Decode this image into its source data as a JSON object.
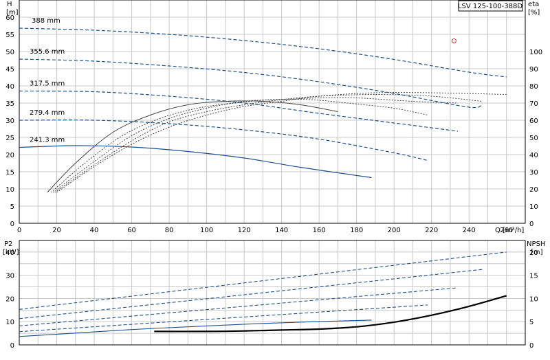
{
  "chart_data": [
    {
      "type": "line",
      "title": "LSV 125-100-388D",
      "xlabel": "Q [m³/h]",
      "ylabel": "H",
      "ylabel_unit": "[m]",
      "y2label": "eta",
      "y2label_unit": "[%]",
      "xlim": [
        0,
        270
      ],
      "ylim": [
        0,
        65
      ],
      "y2lim": [
        0,
        130
      ],
      "xticks": [
        "0",
        "20",
        "40",
        "60",
        "80",
        "100",
        "120",
        "140",
        "160",
        "180",
        "200",
        "220",
        "240",
        "260"
      ],
      "yticks": [
        "0",
        "5",
        "10",
        "15",
        "20",
        "25",
        "30",
        "35",
        "40",
        "45",
        "50",
        "55",
        "60"
      ],
      "y2ticks": [
        "0",
        "10",
        "20",
        "30",
        "40",
        "50",
        "60",
        "70",
        "80",
        "90",
        "100"
      ],
      "grid": true,
      "series": [
        {
          "name": "388 mm",
          "style": "dashed",
          "color": "#1f4f8f",
          "x": [
            0,
            40,
            80,
            120,
            160,
            200,
            240,
            260
          ],
          "y": [
            56.8,
            56.2,
            55.0,
            53.2,
            50.8,
            47.7,
            44.0,
            42.6
          ]
        },
        {
          "name": "355.6 mm",
          "style": "dashed",
          "color": "#1f4f8f",
          "x": [
            0,
            40,
            80,
            120,
            160,
            200,
            240,
            247
          ],
          "y": [
            47.8,
            47.2,
            45.8,
            43.9,
            41.2,
            37.8,
            33.8,
            34.8
          ]
        },
        {
          "name": "317.5 mm",
          "style": "dashed",
          "color": "#1f4f8f",
          "x": [
            0,
            40,
            80,
            120,
            160,
            200,
            234
          ],
          "y": [
            38.5,
            38.3,
            37.0,
            35.0,
            32.0,
            29.2,
            26.8
          ]
        },
        {
          "name": "279.4 mm",
          "style": "dashed",
          "color": "#1f4f8f",
          "x": [
            0,
            40,
            80,
            120,
            160,
            200,
            218
          ],
          "y": [
            30.0,
            30.0,
            29.0,
            27.2,
            24.5,
            20.5,
            18.3
          ]
        },
        {
          "name": "241.3 mm",
          "style": "solid",
          "color": "#1f4f8f",
          "x": [
            0,
            30,
            60,
            90,
            120,
            150,
            188
          ],
          "y": [
            22.1,
            22.6,
            22.2,
            20.9,
            19.0,
            16.3,
            13.3
          ]
        }
      ],
      "efficiency_series": [
        {
          "axis": "eta",
          "style": "solid",
          "color": "#444444",
          "x": [
            15,
            30,
            50,
            70,
            90,
            110,
            130,
            150,
            170
          ],
          "y": [
            18,
            35,
            53,
            63,
            69,
            71,
            71,
            69,
            65
          ]
        },
        {
          "axis": "eta",
          "style": "dotted",
          "color": "#444444",
          "x": [
            17,
            35,
            55,
            75,
            95,
            115,
            135,
            155,
            175,
            200,
            218
          ],
          "y": [
            18,
            35,
            51,
            61,
            67,
            70,
            72,
            72,
            70,
            67,
            63
          ]
        },
        {
          "axis": "eta",
          "style": "dotted",
          "color": "#444444",
          "x": [
            18,
            40,
            60,
            80,
            100,
            120,
            140,
            160,
            180,
            210,
            234
          ],
          "y": [
            18,
            36,
            51,
            61,
            67,
            71,
            72,
            73,
            73,
            71,
            70
          ]
        },
        {
          "axis": "eta",
          "style": "dotted",
          "color": "#444444",
          "x": [
            19,
            40,
            60,
            80,
            100,
            120,
            140,
            160,
            190,
            220,
            247
          ],
          "y": [
            18,
            34,
            48,
            59,
            65,
            69,
            72,
            74,
            75,
            74,
            71
          ]
        },
        {
          "axis": "eta",
          "style": "dotted",
          "color": "#444444",
          "x": [
            20,
            40,
            60,
            80,
            100,
            120,
            140,
            160,
            190,
            220,
            260
          ],
          "y": [
            18,
            33,
            46,
            56,
            63,
            68,
            71,
            74,
            76,
            76,
            75
          ]
        }
      ],
      "operating_point": {
        "x": 232,
        "y": 53.1,
        "color": "#e03030"
      }
    },
    {
      "type": "line",
      "xlabel": "",
      "ylabel": "P2",
      "ylabel_unit": "[kW]",
      "y2label": "NPSH",
      "y2label_unit": "[m]",
      "xlim": [
        0,
        270
      ],
      "ylim": [
        0,
        45
      ],
      "y2lim": [
        0,
        22.5
      ],
      "yticks": [
        "0",
        "10",
        "20",
        "30",
        "40"
      ],
      "y2ticks": [
        "0",
        "5",
        "10",
        "15",
        "20"
      ],
      "grid": true,
      "series": [
        {
          "style": "dashed",
          "color": "#1f4f8f",
          "x": [
            0,
            260
          ],
          "y": [
            15.3,
            40.0
          ]
        },
        {
          "style": "dashed",
          "color": "#1f4f8f",
          "x": [
            0,
            247
          ],
          "y": [
            11.3,
            32.5
          ]
        },
        {
          "style": "dashed",
          "color": "#1f4f8f",
          "x": [
            0,
            234
          ],
          "y": [
            8.2,
            24.6
          ]
        },
        {
          "style": "dashed",
          "color": "#1f4f8f",
          "x": [
            0,
            218
          ],
          "y": [
            5.7,
            17.2
          ]
        },
        {
          "style": "solid",
          "color": "#1f4f8f",
          "x": [
            0,
            30,
            60,
            90,
            120,
            150,
            188
          ],
          "y": [
            3.6,
            5.1,
            6.6,
            7.8,
            8.9,
            9.8,
            10.7
          ]
        }
      ],
      "npsh_series": {
        "style": "solid",
        "color": "#000000",
        "x": [
          72,
          100,
          120,
          140,
          160,
          180,
          200,
          220,
          240,
          260
        ],
        "y2": [
          2.9,
          2.9,
          3.0,
          3.2,
          3.4,
          3.9,
          4.9,
          6.4,
          8.3,
          10.6
        ]
      }
    }
  ]
}
